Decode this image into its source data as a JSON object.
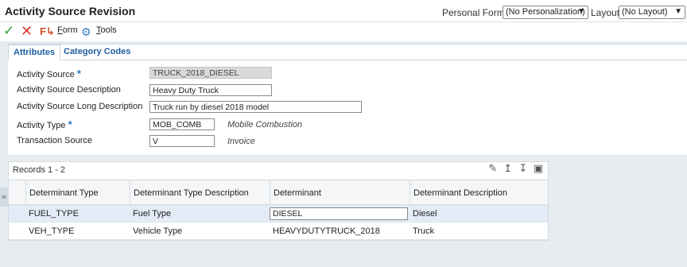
{
  "header": {
    "title": "Activity Source Revision",
    "personal_form_label": "Personal Form:",
    "personal_form_value": "(No Personalization)",
    "layout_label": "Layout:",
    "layout_value": "(No Layout)"
  },
  "toolbar": {
    "form_label_underlined": "F",
    "form_label_rest": "orm",
    "tools_label_underlined": "T",
    "tools_label_rest": "ools"
  },
  "tabs": [
    {
      "label": "Attributes",
      "active": true
    },
    {
      "label": "Category Codes",
      "active": false
    }
  ],
  "form": {
    "activity_source": {
      "label": "Activity Source",
      "required": true,
      "value": "TRUCK_2018_DIESEL"
    },
    "activity_source_description": {
      "label": "Activity Source Description",
      "value": "Heavy Duty Truck"
    },
    "activity_source_long_description": {
      "label": "Activity Source Long Description",
      "value": "Truck run by diesel 2018 model"
    },
    "activity_type": {
      "label": "Activity Type",
      "required": true,
      "value": "MOB_COMB",
      "description": "Mobile Combustion"
    },
    "transaction_source": {
      "label": "Transaction Source",
      "value": "V",
      "description": "Invoice"
    }
  },
  "grid": {
    "records_label": "Records 1 - 2",
    "columns": [
      "Determinant Type",
      "Determinant Type Description",
      "Determinant",
      "Determinant Description"
    ],
    "rows": [
      {
        "type": "FUEL_TYPE",
        "type_description": "Fuel Type",
        "determinant": "DIESEL",
        "description": "Diesel"
      },
      {
        "type": "VEH_TYPE",
        "type_description": "Vehicle Type",
        "determinant": "HEAVYDUTYTRUCK_2018",
        "description": "Truck"
      }
    ]
  },
  "colors": {
    "accent": "#1d5e9f",
    "required": "#2b78c5",
    "ok": "#3a9a3a",
    "cancel": "#d43a2a",
    "selected_row": "#e3ecf6"
  }
}
